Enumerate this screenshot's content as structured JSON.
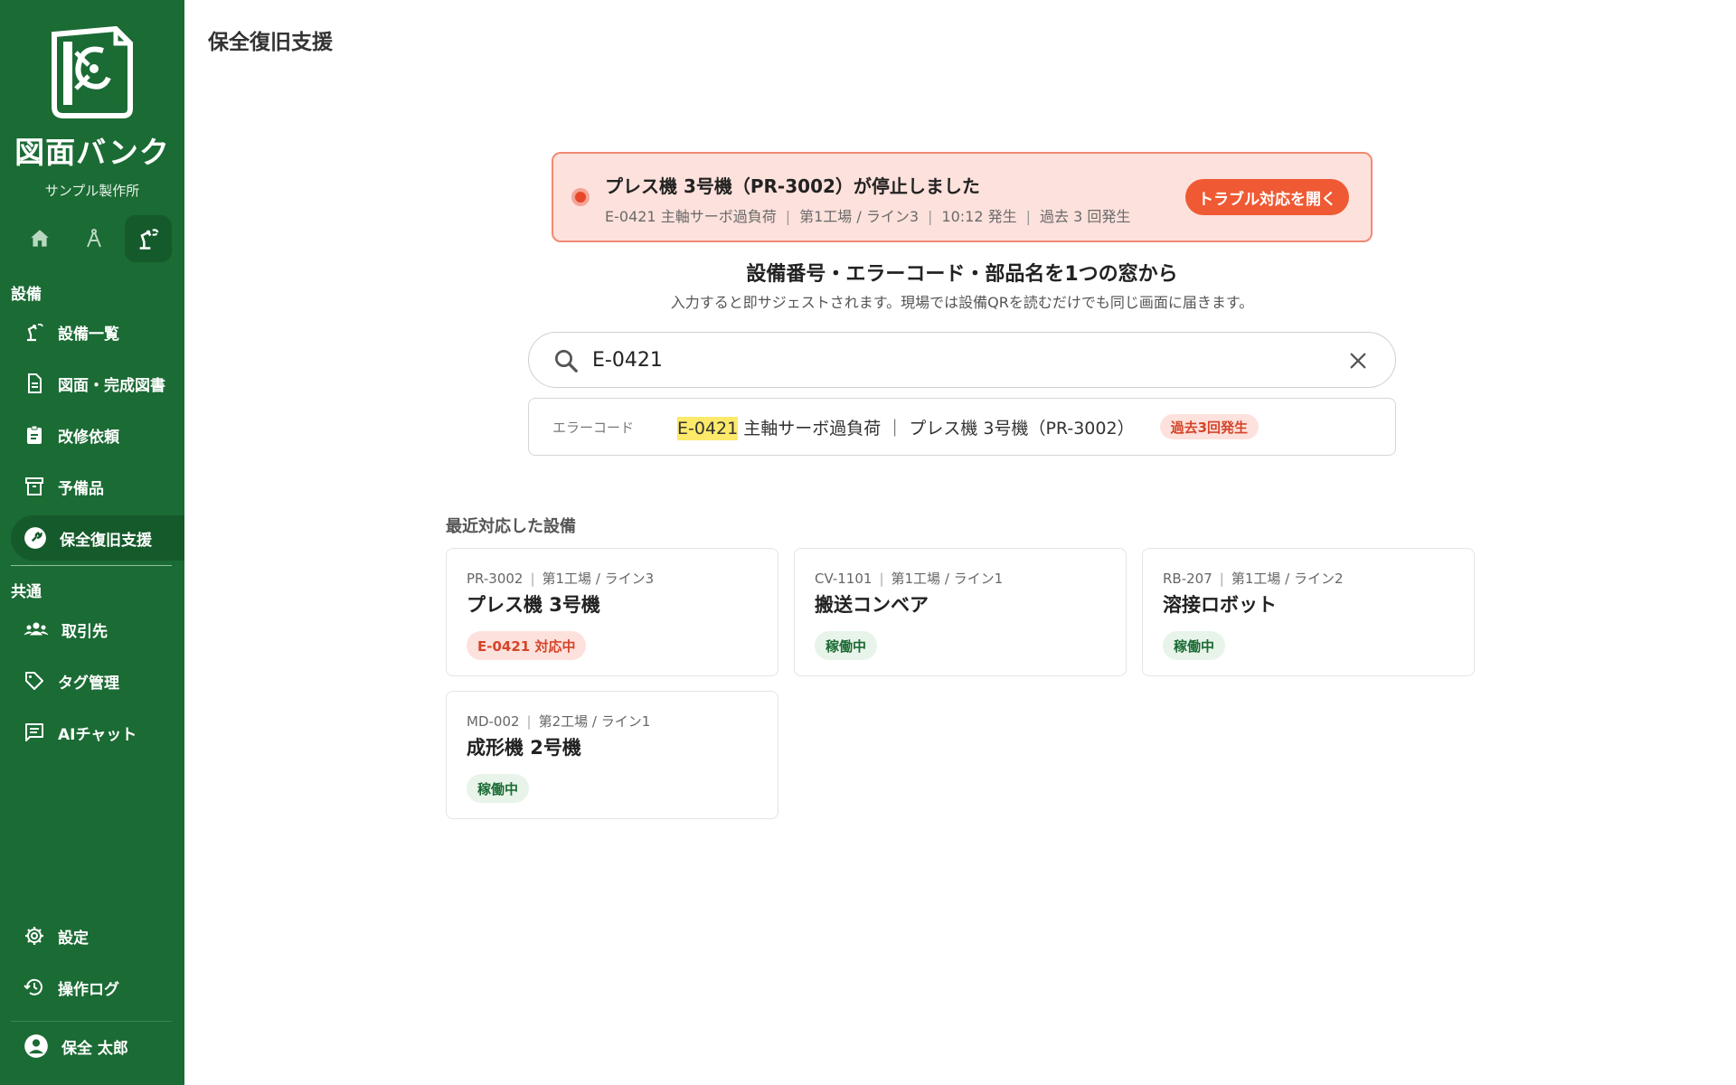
{
  "sidebar": {
    "brand": "図面バンク",
    "company": "サンプル製作所",
    "sections": {
      "equipment": "設備",
      "common": "共通"
    },
    "items": [
      {
        "label": "設備一覧",
        "icon": "machine-icon"
      },
      {
        "label": "図面・完成図書",
        "icon": "document-icon"
      },
      {
        "label": "改修依頼",
        "icon": "clipboard-icon"
      },
      {
        "label": "予備品",
        "icon": "archive-icon"
      },
      {
        "label": "保全復旧支援",
        "icon": "wrench-icon",
        "active": true
      },
      {
        "label": "取引先",
        "icon": "people-icon"
      },
      {
        "label": "タグ管理",
        "icon": "tag-icon"
      },
      {
        "label": "AIチャット",
        "icon": "chat-icon"
      },
      {
        "label": "設定",
        "icon": "gear-icon"
      },
      {
        "label": "操作ログ",
        "icon": "history-icon"
      }
    ],
    "user": "保全 太郎"
  },
  "header": {
    "title": "保全復旧支援"
  },
  "alert": {
    "title": "プレス機 3号機（PR-3002）が停止しました",
    "meta": [
      "E-0421 主軸サーボ過負荷",
      "第1工場 / ライン3",
      "10:12 発生",
      "過去 3 回発生"
    ],
    "button": "トラブル対応を開く"
  },
  "search": {
    "heading": "設備番号・エラーコード・部品名を1つの窓から",
    "subtitle": "入力すると即サジェストされます。現場では設備QRを読むだけでも同じ画面に届きます。",
    "value": "E-0421"
  },
  "suggestion": {
    "type": "エラーコード",
    "highlight": "E-0421",
    "text": " 主軸サーボ過負荷 ｜ プレス機 3号機（PR-3002）",
    "badge": "過去3回発生"
  },
  "recent": {
    "title": "最近対応した設備",
    "cards": [
      {
        "code": "PR-3002",
        "location": "第1工場 / ライン3",
        "name": "プレス機 3号機",
        "status": "E-0421 対応中",
        "status_type": "alert"
      },
      {
        "code": "CV-1101",
        "location": "第1工場 / ライン1",
        "name": "搬送コンベア",
        "status": "稼働中",
        "status_type": "ok"
      },
      {
        "code": "RB-207",
        "location": "第1工場 / ライン2",
        "name": "溶接ロボット",
        "status": "稼働中",
        "status_type": "ok"
      },
      {
        "code": "MD-002",
        "location": "第2工場 / ライン1",
        "name": "成形機 2号機",
        "status": "稼働中",
        "status_type": "ok"
      }
    ]
  },
  "colors": {
    "sidebar": "#1b6b34",
    "accent": "#ef5a34",
    "alert_bg": "#fde1dc",
    "highlight": "#fde96a"
  }
}
